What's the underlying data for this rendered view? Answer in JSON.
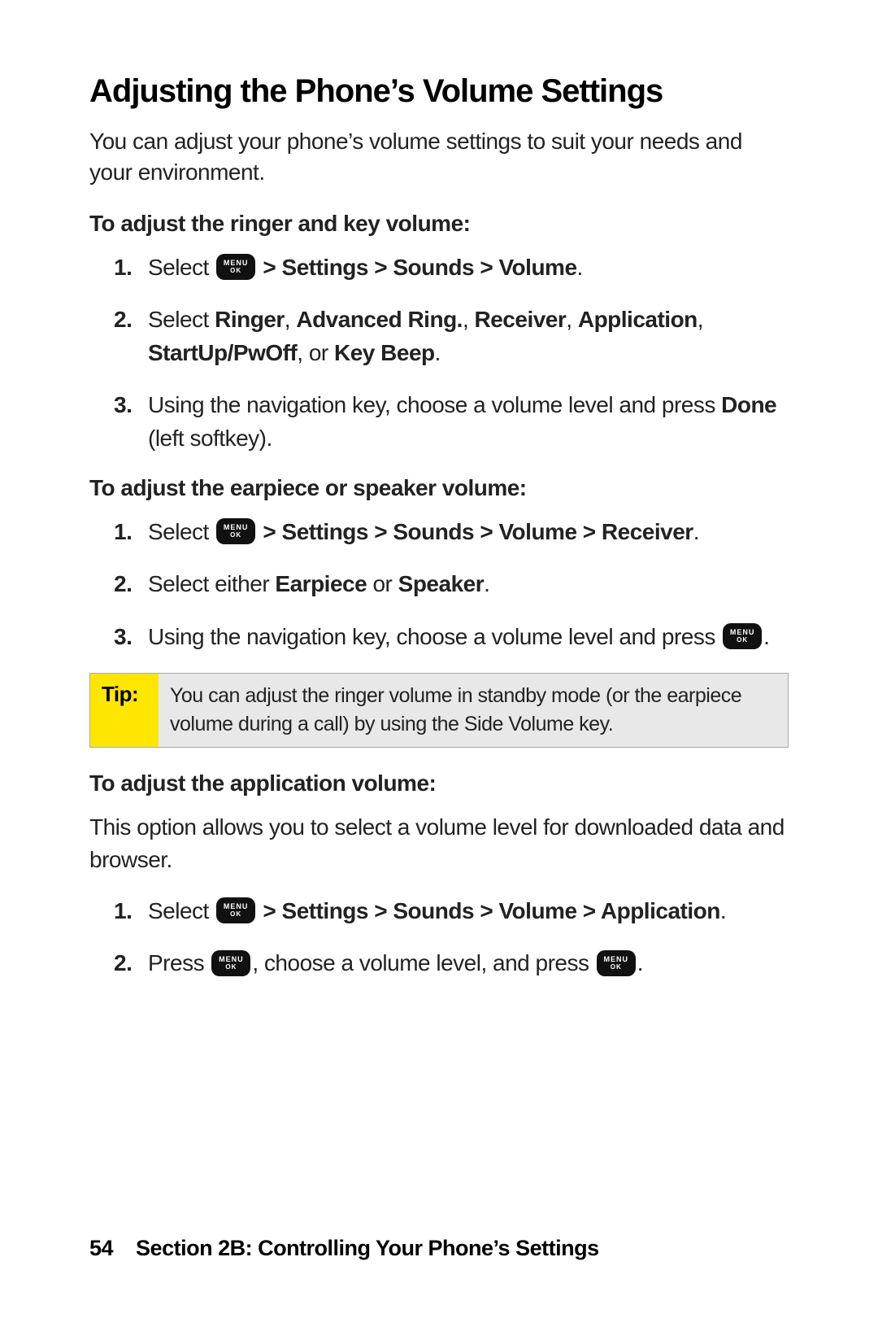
{
  "title": "Adjusting the Phone’s Volume Settings",
  "intro": "You can adjust your phone’s volume settings to suit your needs and your environment.",
  "menu_key": {
    "top": "MENU",
    "bottom": "OK"
  },
  "sectionA": {
    "heading": "To adjust the ringer and key volume:",
    "step1_pre": "Select ",
    "step1_post": " > Settings > Sounds > Volume",
    "step1_end": ".",
    "step2_pre": "Select ",
    "step2_b1": "Ringer",
    "step2_t1": ", ",
    "step2_b2": "Advanced Ring.",
    "step2_t2": ", ",
    "step2_b3": "Receiver",
    "step2_t3": ", ",
    "step2_b4": "Application",
    "step2_t4": ", ",
    "step2_b5": "StartUp/PwOff",
    "step2_t5": ", or ",
    "step2_b6": "Key Beep",
    "step2_end": ".",
    "step3_pre": "Using the navigation key, choose a volume level and press ",
    "step3_b": "Done",
    "step3_post": " (left softkey)."
  },
  "sectionB": {
    "heading": "To adjust the earpiece or speaker volume:",
    "step1_pre": "Select ",
    "step1_post": " > Settings > Sounds > Volume > Receiver",
    "step1_end": ".",
    "step2_pre": "Select either ",
    "step2_b1": "Earpiece",
    "step2_t1": " or ",
    "step2_b2": "Speaker",
    "step2_end": ".",
    "step3_pre": "Using the navigation key, choose a volume level and press ",
    "step3_end": "."
  },
  "tip": {
    "label": "Tip:",
    "text": "You can adjust the ringer volume in standby mode (or the earpiece volume during a call) by using the Side Volume key."
  },
  "sectionC": {
    "heading": "To adjust the application volume:",
    "body": "This option allows you to select a volume level for downloaded data and browser.",
    "step1_pre": "Select ",
    "step1_post": " > Settings > Sounds > Volume > Application",
    "step1_end": ".",
    "step2_pre": "Press ",
    "step2_mid": ", choose a volume level, and press ",
    "step2_end": "."
  },
  "footer": {
    "page_number": "54",
    "section_label": "Section 2B: Controlling Your Phone’s Settings"
  },
  "nums": {
    "n1": "1.",
    "n2": "2.",
    "n3": "3."
  }
}
